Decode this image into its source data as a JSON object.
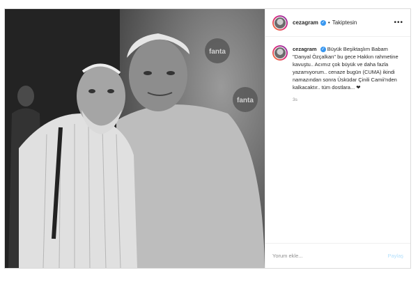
{
  "post": {
    "username": "cezagram",
    "verified_icon": "verified-badge-icon",
    "separator": "•",
    "follow_label": "Takiptesin",
    "more_icon": "•••",
    "caption": "Büyük Beşiktaşlım Babam \"Danyal Özçalkan\" bu gece Hakkın rahmetine kavuştu.. Acımız çok büyük ve daha fazla yazamıyorum.. cenaze bugün (CUMA) ikindi namazından sonra Üsküdar Çinili Camii'nden kalkacaktır.. tüm dostlara... ❤",
    "timestamp": "3s",
    "comment_placeholder": "Yorum ekle...",
    "post_button": "Paylaş"
  },
  "photo": {
    "brand_text": "fanta"
  },
  "colors": {
    "accent": "#3897f0",
    "post_disabled": "#b2dffc",
    "border": "#dbdbdb"
  }
}
